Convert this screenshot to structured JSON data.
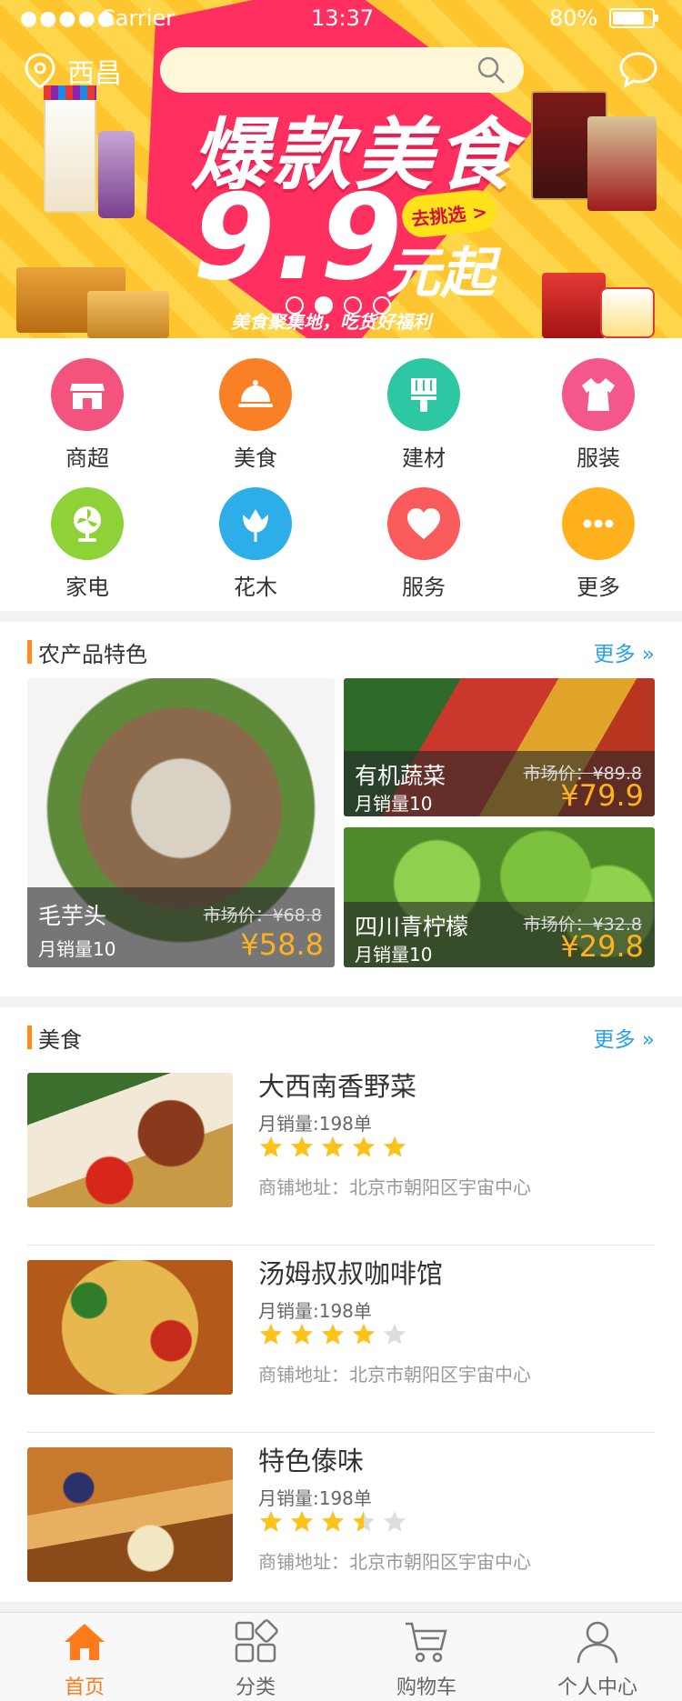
{
  "status_bar": {
    "signal": "●●●●●",
    "carrier": "Carrier",
    "time": "13:37",
    "battery": "80%"
  },
  "header": {
    "location": "西昌",
    "search_placeholder": ""
  },
  "banner": {
    "title": "爆款美食",
    "price": "9.9",
    "unit": "元起",
    "cta": "去挑选 >",
    "slogan": "美食聚集地，吃货好福利",
    "slides": 4,
    "active_slide": 1
  },
  "categories": [
    {
      "label": "商超",
      "icon": "store-icon",
      "color": "#f2547e"
    },
    {
      "label": "美食",
      "icon": "food-cover-icon",
      "color": "#f98024"
    },
    {
      "label": "建材",
      "icon": "brush-icon",
      "color": "#2ec7a3"
    },
    {
      "label": "服装",
      "icon": "dress-icon",
      "color": "#f4578a"
    },
    {
      "label": "家电",
      "icon": "fan-icon",
      "color": "#8fd237"
    },
    {
      "label": "花木",
      "icon": "flower-icon",
      "color": "#2eaee8"
    },
    {
      "label": "服务",
      "icon": "heart-icon",
      "color": "#f95b5b"
    },
    {
      "label": "更多",
      "icon": "more-icon",
      "color": "#ffb11e"
    }
  ],
  "agri": {
    "title": "农产品特色",
    "more": "更多",
    "items": [
      {
        "name": "毛芋头",
        "sales": "月销量10",
        "market": "市场价：¥68.8",
        "price": "¥58.8"
      },
      {
        "name": "有机蔬菜",
        "sales": "月销量10",
        "market": "市场价：¥89.8",
        "price": "¥79.9"
      },
      {
        "name": "四川青柠檬",
        "sales": "月销量10",
        "market": "市场价：¥32.8",
        "price": "¥29.8"
      }
    ]
  },
  "food": {
    "title": "美食",
    "more": "更多",
    "items": [
      {
        "name": "大西南香野菜",
        "sales": "月销量:198单",
        "rating": 5,
        "address": "商铺地址：北京市朝阳区宇宙中心"
      },
      {
        "name": "汤姆叔叔咖啡馆",
        "sales": "月销量:198单",
        "rating": 4,
        "address": "商铺地址：北京市朝阳区宇宙中心"
      },
      {
        "name": "特色傣味",
        "sales": "月销量:198单",
        "rating": 3.5,
        "address": "商铺地址：北京市朝阳区宇宙中心"
      }
    ]
  },
  "tabbar": {
    "items": [
      {
        "label": "首页",
        "icon": "home-icon",
        "active": true
      },
      {
        "label": "分类",
        "icon": "category-icon",
        "active": false
      },
      {
        "label": "购物车",
        "icon": "cart-icon",
        "active": false
      },
      {
        "label": "个人中心",
        "icon": "user-icon",
        "active": false
      }
    ]
  },
  "colors": {
    "accent": "#ff7a1a",
    "link": "#2aa0e6",
    "price": "#ffb21e",
    "star": "#ffc21a",
    "star_empty": "#dddddd"
  }
}
